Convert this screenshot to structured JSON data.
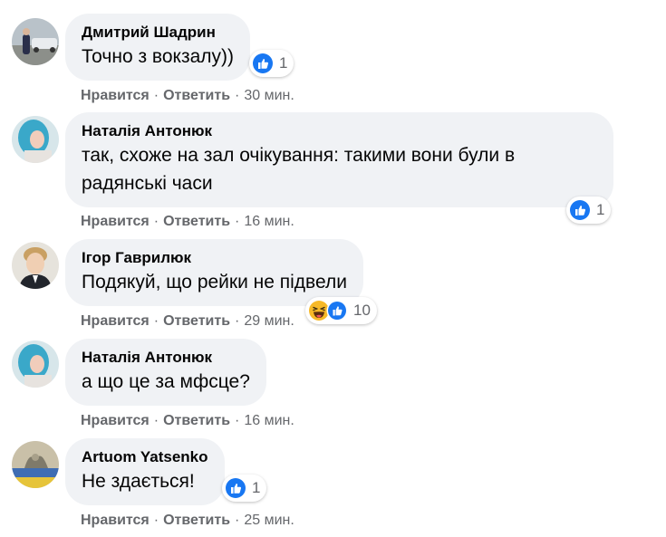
{
  "actions": {
    "like_label": "Нравится",
    "reply_label": "Ответить",
    "separator": "·"
  },
  "colors": {
    "bubble": "#f0f2f5",
    "meta_text": "#65676b",
    "like_blue": "#1877f2",
    "haha_yellow": "#f7b928"
  },
  "comments": [
    {
      "author": "Дмитрий Шадрин",
      "text": "Точно з вокзалу))",
      "time": "30 мин.",
      "reactions": [
        "like-icon"
      ],
      "reaction_count": "1"
    },
    {
      "author": "Наталія Антонюк",
      "text": "так, схоже на зал очікування: такими вони були в\nрадянські часи",
      "time": "16 мин.",
      "reactions": [
        "like-icon"
      ],
      "reaction_count": "1"
    },
    {
      "author": "Ігор Гаврилюк",
      "text": "Подякуй, що рейки не підвели",
      "time": "29 мин.",
      "reactions": [
        "haha-icon",
        "like-icon"
      ],
      "reaction_count": "10"
    },
    {
      "author": "Наталія Антонюк",
      "text": "а що це за мфсце?",
      "time": "16 мин.",
      "reactions": [],
      "reaction_count": ""
    },
    {
      "author": "Artuom Yatsenko",
      "text": "Не здається!",
      "time": "25 мин.",
      "reactions": [
        "like-icon"
      ],
      "reaction_count": "1"
    }
  ]
}
